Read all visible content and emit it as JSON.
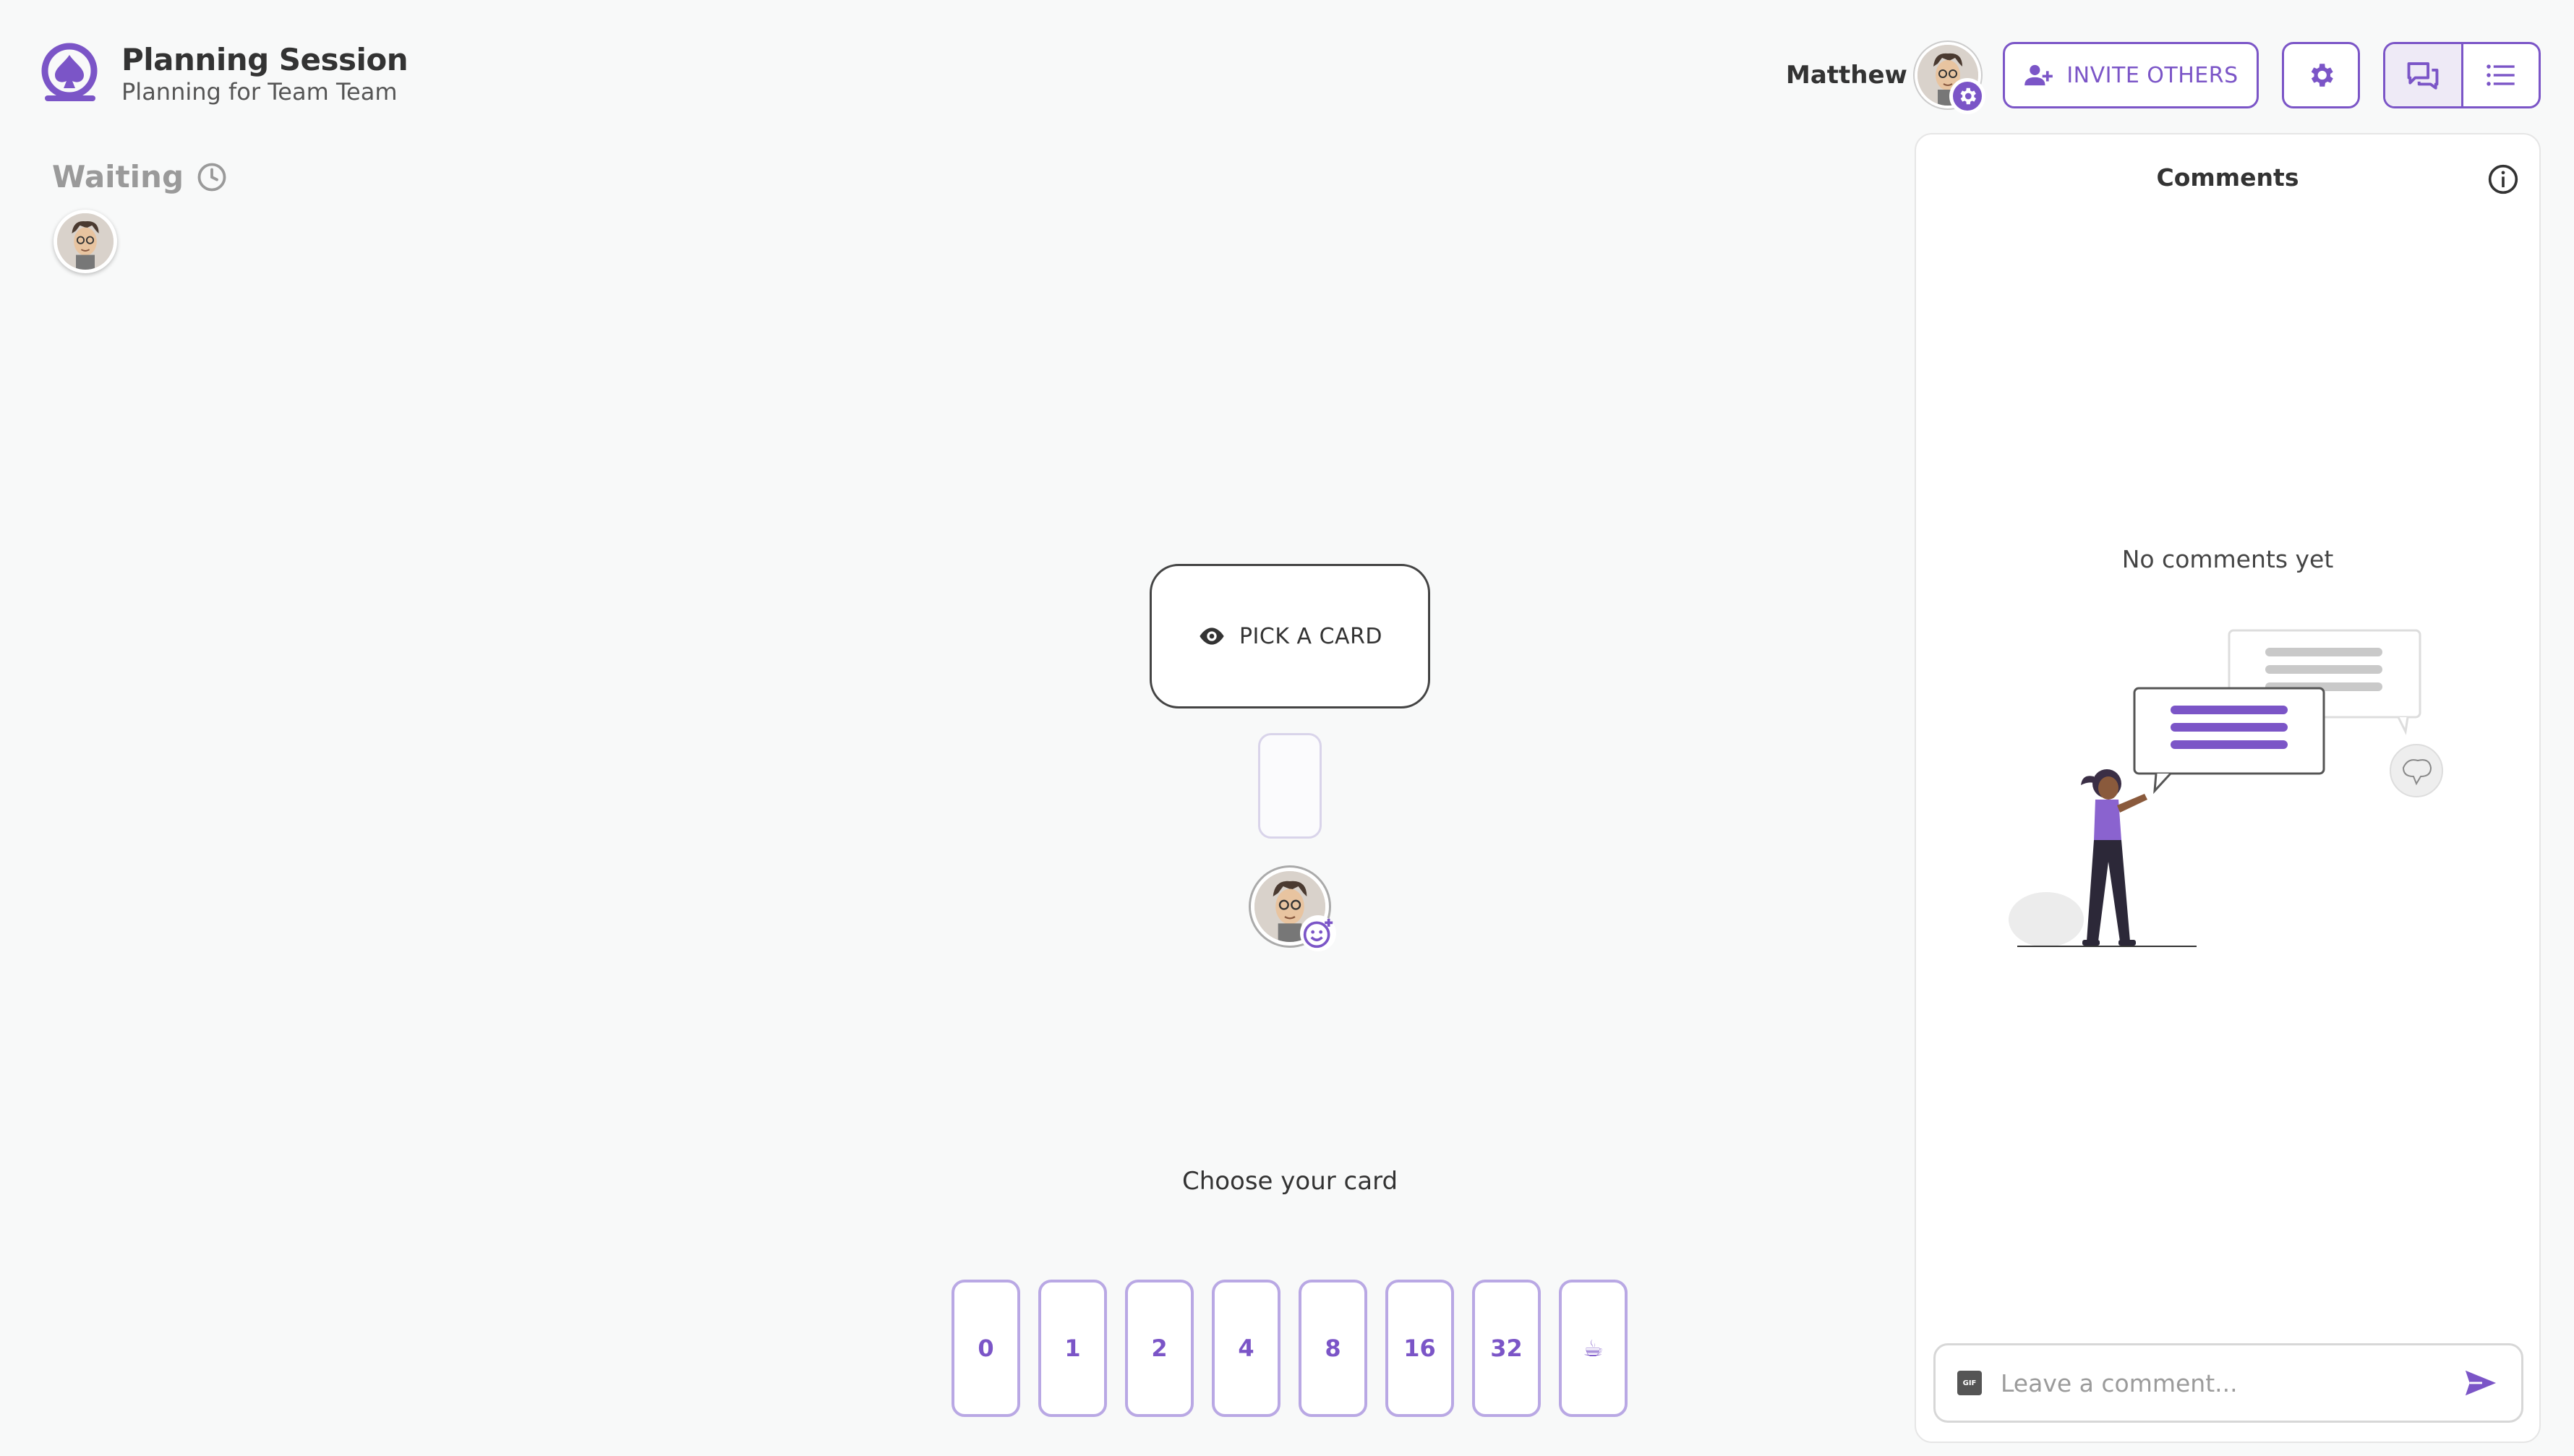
{
  "header": {
    "title": "Planning Session",
    "subtitle": "Planning for Team Team",
    "user_name": "Matthew",
    "invite_label": "INVITE OTHERS"
  },
  "waiting": {
    "label": "Waiting"
  },
  "table": {
    "pick_label": "PICK A CARD",
    "choose_text": "Choose your card"
  },
  "deck": {
    "cards": [
      "0",
      "1",
      "2",
      "4",
      "8",
      "16",
      "32",
      "☕"
    ]
  },
  "comments": {
    "title": "Comments",
    "empty_text": "No comments yet",
    "input_placeholder": "Leave a comment...",
    "gif_label": "GIF"
  },
  "colors": {
    "accent": "#7b55c7",
    "background": "#f8f9f9"
  },
  "icons": {
    "logo": "spade-logo-icon",
    "invite": "user-plus-icon",
    "settings": "gear-icon",
    "chat": "chat-icon",
    "list": "list-icon",
    "waiting": "clock-icon",
    "pick": "eye-icon",
    "emoji": "emoji-add-icon",
    "info": "info-icon",
    "send": "send-icon"
  }
}
